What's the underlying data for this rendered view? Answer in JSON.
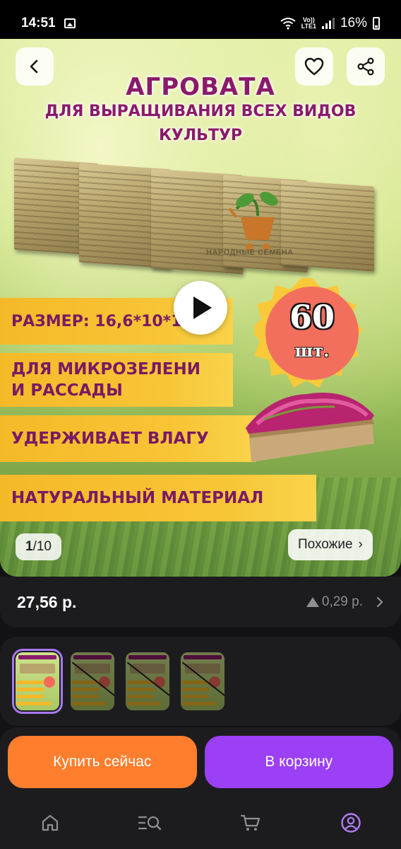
{
  "status_bar": {
    "time": "14:51",
    "network_top": "Vo))",
    "network_bottom": "LTE1",
    "battery": "16%"
  },
  "hero": {
    "title": "АГРОВАТА",
    "subtitle_line1": "ДЛЯ ВЫРАЩИВАНИЯ ВСЕХ ВИДОВ",
    "subtitle_line2": "КУЛЬТУР",
    "logo_text": "НАРОДНЫЕ СЕМЕНА",
    "banners": {
      "size": "РАЗМЕР: 16,6*10*1 СМ",
      "use_line1": "ДЛЯ МИКРОЗЕЛЕНИ",
      "use_line2": "И РАССАДЫ",
      "moisture": "УДЕРЖИВАЕТ ВЛАГУ",
      "material": "НАТУРАЛЬНЫЙ МАТЕРИАЛ"
    },
    "badge_number": "60",
    "badge_unit": "шт.",
    "counter_current": "1",
    "counter_total": "10",
    "similar_label": "Похожие",
    "similar_chevron": "›"
  },
  "price": {
    "value": "27,56 р.",
    "change": "0,29 р."
  },
  "actions": {
    "buy_now": "Купить сейчас",
    "add_to_cart": "В корзину"
  },
  "colors": {
    "accent_orange": "#ff7e2d",
    "accent_purple": "#9b40f5",
    "title_magenta": "#8a1a6b",
    "banner_yellow": "#f5b928"
  },
  "icons": {
    "back": "chevron-left-icon",
    "favorite": "heart-icon",
    "share": "share-icon",
    "play": "play-icon",
    "home": "home-icon",
    "catalog": "catalog-search-icon",
    "cart": "cart-icon",
    "profile": "profile-icon"
  }
}
